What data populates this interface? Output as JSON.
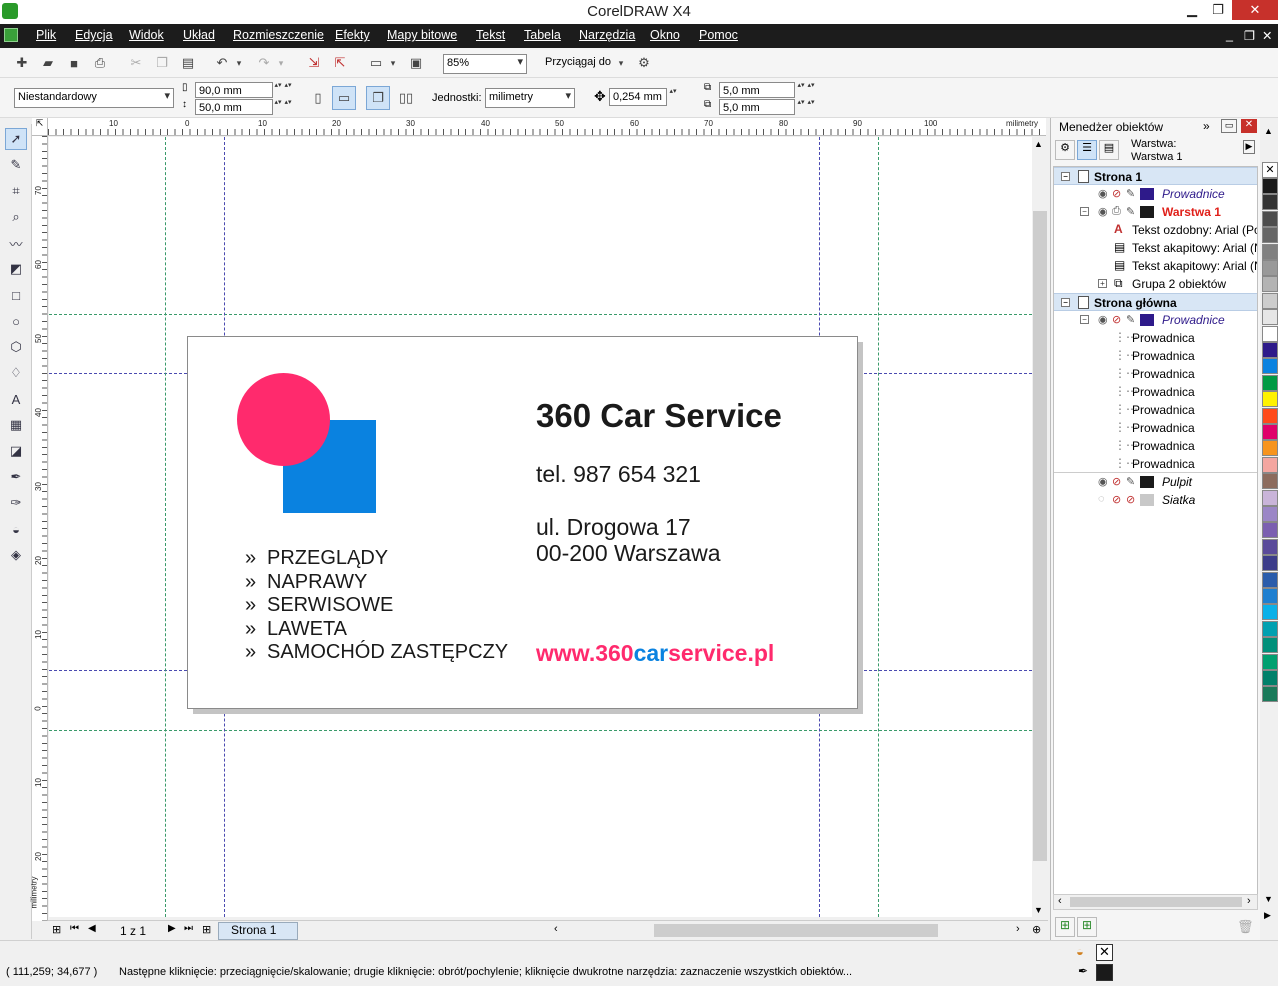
{
  "window": {
    "title": "CorelDRAW X4",
    "minimize": "▁",
    "restore": "❐",
    "close": "✕"
  },
  "menu": [
    "Plik",
    "Edycja",
    "Widok",
    "Układ",
    "Rozmieszczenie",
    "Efekty",
    "Mapy bitowe",
    "Tekst",
    "Tabela",
    "Narzędzia",
    "Okno",
    "Pomoc"
  ],
  "menu_right": {
    "min": "_",
    "restore": "❐",
    "close": "✕"
  },
  "std_toolbar": {
    "zoom": "85%",
    "snap_label": "Przyciągaj do"
  },
  "prop_bar": {
    "paper": "Niestandardowy",
    "width": "90,0 mm",
    "height": "50,0 mm",
    "units_label": "Jednostki:",
    "units": "milimetry",
    "nudge": "0,254 mm",
    "dup_x": "5,0 mm",
    "dup_y": "5,0 mm"
  },
  "ruler": {
    "h_labels": [
      "10",
      "0",
      "10",
      "20",
      "30",
      "40",
      "50",
      "60",
      "70",
      "80",
      "90",
      "100"
    ],
    "h_unit": "milimetry",
    "v_labels": [
      "70",
      "60",
      "50",
      "40",
      "30",
      "20",
      "10",
      "0",
      "10",
      "20"
    ],
    "v_unit": "milimetry"
  },
  "card": {
    "company": "360 Car Service",
    "phone": "tel. 987 654 321",
    "address1": "ul. Drogowa 17",
    "address2": "00-200 Warszawa",
    "bullet": "»",
    "services": [
      "PRZEGLĄDY",
      "NAPRAWY",
      "SERWISOWE",
      "LAWETA",
      "SAMOCHÓD ZASTĘPCZY"
    ],
    "web_prefix": "www.360",
    "web_mid": "car",
    "web_suffix": "service.pl",
    "colors": {
      "pink": "#ff2a6d",
      "blue": "#0a82e0",
      "text": "#1a1a1a"
    }
  },
  "doc_nav": {
    "page_count": "1 z 1",
    "tab": "Strona 1"
  },
  "status": {
    "coords": "( 111,259; 34,677 )",
    "hint": "Następne kliknięcie: przeciągnięcie/skalowanie; drugie kliknięcie: obrót/pochylenie; kliknięcie dwukrotne narzędzia: zaznaczenie wszystkich obiektów..."
  },
  "docker": {
    "title": "Menedżer obiektów",
    "layer_label": "Warstwa:",
    "layer_name": "Warstwa 1",
    "tree": [
      {
        "label": "Strona 1",
        "kind": "page",
        "indent": 0
      },
      {
        "label": "Prowadnice",
        "kind": "guides-layer",
        "indent": 1
      },
      {
        "label": "Warstwa 1",
        "kind": "active-layer",
        "indent": 1
      },
      {
        "label": "Tekst ozdobny: Arial (Pogrubienie) (POL)",
        "kind": "artistic-text",
        "indent": 2
      },
      {
        "label": "Tekst akapitowy: Arial (Normalny) (POL)",
        "kind": "paragraph-text",
        "indent": 2
      },
      {
        "label": "Tekst akapitowy: Arial (Normalny) (POL)",
        "kind": "paragraph-text",
        "indent": 2
      },
      {
        "label": "Grupa 2 obiektów",
        "kind": "group",
        "indent": 2
      },
      {
        "label": "Strona główna",
        "kind": "page",
        "indent": 0
      },
      {
        "label": "Prowadnice",
        "kind": "guides-layer",
        "indent": 1
      },
      {
        "label": "Prowadnica",
        "kind": "guide",
        "indent": 2
      },
      {
        "label": "Prowadnica",
        "kind": "guide",
        "indent": 2
      },
      {
        "label": "Prowadnica",
        "kind": "guide",
        "indent": 2
      },
      {
        "label": "Prowadnica",
        "kind": "guide",
        "indent": 2
      },
      {
        "label": "Prowadnica",
        "kind": "guide",
        "indent": 2
      },
      {
        "label": "Prowadnica",
        "kind": "guide",
        "indent": 2
      },
      {
        "label": "Prowadnica",
        "kind": "guide",
        "indent": 2
      },
      {
        "label": "Prowadnica",
        "kind": "guide",
        "indent": 2
      },
      {
        "label": "Pulpit",
        "kind": "master-layer",
        "indent": 1
      },
      {
        "label": "Siatka",
        "kind": "master-layer",
        "indent": 1
      }
    ]
  },
  "palette": [
    "#ffffff",
    "#1a1a1a",
    "#333333",
    "#4d4d4d",
    "#666666",
    "#808080",
    "#999999",
    "#b3b3b3",
    "#cccccc",
    "#e6e6e6",
    "#ffffff",
    "#2e1a8a",
    "#0a82e0",
    "#009a44",
    "#fff200",
    "#ff4a1a",
    "#e0006a",
    "#f7941d",
    "#f4a6a0",
    "#8c6b5d",
    "#c9b4d9",
    "#9b86c6",
    "#7b5fb0",
    "#5a4a9a",
    "#3c3c8a",
    "#2a5cab",
    "#1e7fd0",
    "#0ab0e8",
    "#00a0b0",
    "#00907a",
    "#00a070",
    "#00806a",
    "#1a7a5a"
  ]
}
